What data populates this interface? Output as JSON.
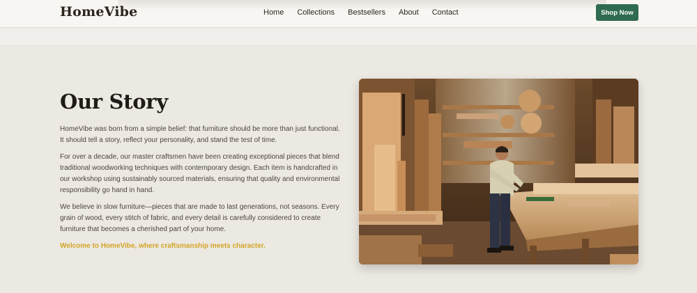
{
  "header": {
    "brand": "HomeVibe",
    "nav": [
      "Home",
      "Collections",
      "Bestsellers",
      "About",
      "Contact"
    ],
    "cta": "Shop Now"
  },
  "story": {
    "title": "Our Story",
    "paragraphs": [
      "HomeVibe was born from a simple belief: that furniture should be more than just functional. It should tell a story, reflect your personality, and stand the test of time.",
      "For over a decade, our master craftsmen have been creating exceptional pieces that blend traditional woodworking techniques with contemporary design. Each item is handcrafted in our workshop using sustainably sourced materials, ensuring that quality and environmental responsibility go hand in hand.",
      "We believe in slow furniture—pieces that are made to last generations, not seasons. Every grain of wood, every stitch of fabric, and every detail is carefully considered to create furniture that becomes a cherished part of your home."
    ],
    "tagline": "Welcome to HomeVibe, where craftsmanship meets character."
  },
  "colors": {
    "accent": "#2f6b51",
    "tagline": "#d2a526",
    "background": "#ece8e2"
  }
}
